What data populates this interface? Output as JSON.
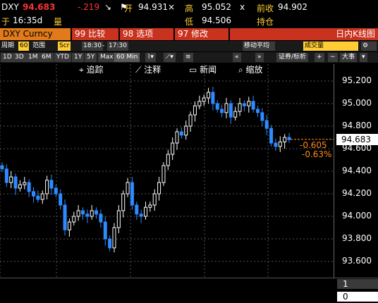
{
  "header": {
    "ticker": "DXY",
    "last": "94.683",
    "change": "-.219",
    "x_mark": "×",
    "open_label": "开",
    "open": "94.931",
    "high_label": "高",
    "high": "95.052",
    "prev_close_label": "前收",
    "prev_close": "94.902",
    "time_label": "于",
    "time": "16:35d",
    "volume_label": "量",
    "low_label": "低",
    "low": "94.506",
    "position_label": "持仓"
  },
  "tabs": {
    "security": "DXY Curncy",
    "compare": "99 比较",
    "options": "98 选项",
    "edit": "97 修改",
    "chart_type": "日内K线图"
  },
  "controls": {
    "period_label": "周期",
    "period_value": "60",
    "range_label": "范围",
    "scr": "Scr",
    "start_time": "18:30",
    "end_time": "17:30",
    "moving_avg": "移动平均",
    "volume_close": "成交量"
  },
  "ranges": {
    "items": [
      "1D",
      "3D",
      "1M",
      "6M",
      "YTD",
      "1Y",
      "5Y",
      "Max",
      "60 Min"
    ],
    "selected": "60 Min"
  },
  "toolbar": {
    "track": "追踪",
    "annotate": "注释",
    "news": "新闻",
    "zoom": "缩放",
    "security_label": "证券/标析",
    "size_label": "大事"
  },
  "yaxis": {
    "ticks": [
      "95.200",
      "95.000",
      "94.800",
      "94.600",
      "94.400",
      "94.200",
      "94.000",
      "93.800",
      "93.600"
    ]
  },
  "last_price_box": "94.683",
  "delta": {
    "abs": "-0.605",
    "pct": "-0.63%"
  },
  "bottom": {
    "top_val": "1",
    "bot_val": "0"
  },
  "colors": {
    "up": "#ffffff",
    "down": "#2e8bff",
    "accent": "#c8321e",
    "orange": "#e07a1a",
    "price_red": "#ff3333"
  },
  "chart_data": {
    "type": "candlestick",
    "ylim": [
      93.5,
      95.3
    ],
    "yticks": [
      95.2,
      95.0,
      94.8,
      94.6,
      94.4,
      94.2,
      94.0,
      93.8,
      93.6
    ],
    "last": 94.683,
    "closes": [
      94.42,
      94.3,
      94.35,
      94.25,
      94.28,
      94.3,
      94.22,
      94.18,
      94.15,
      94.2,
      94.32,
      94.25,
      94.2,
      94.1,
      93.88,
      93.95,
      94.0,
      94.05,
      94.02,
      94.0,
      94.05,
      94.02,
      93.95,
      93.8,
      93.72,
      93.9,
      94.05,
      94.2,
      94.3,
      94.1,
      94.02,
      94.0,
      94.08,
      94.1,
      94.2,
      94.3,
      94.45,
      94.55,
      94.65,
      94.75,
      94.72,
      94.8,
      94.9,
      94.98,
      95.02,
      95.05,
      95.1,
      95.0,
      94.95,
      94.92,
      95.0,
      94.88,
      94.93,
      95.0,
      94.98,
      95.02,
      94.95,
      94.92,
      94.85,
      94.78,
      94.65,
      94.62,
      94.66,
      94.7,
      94.68
    ]
  }
}
